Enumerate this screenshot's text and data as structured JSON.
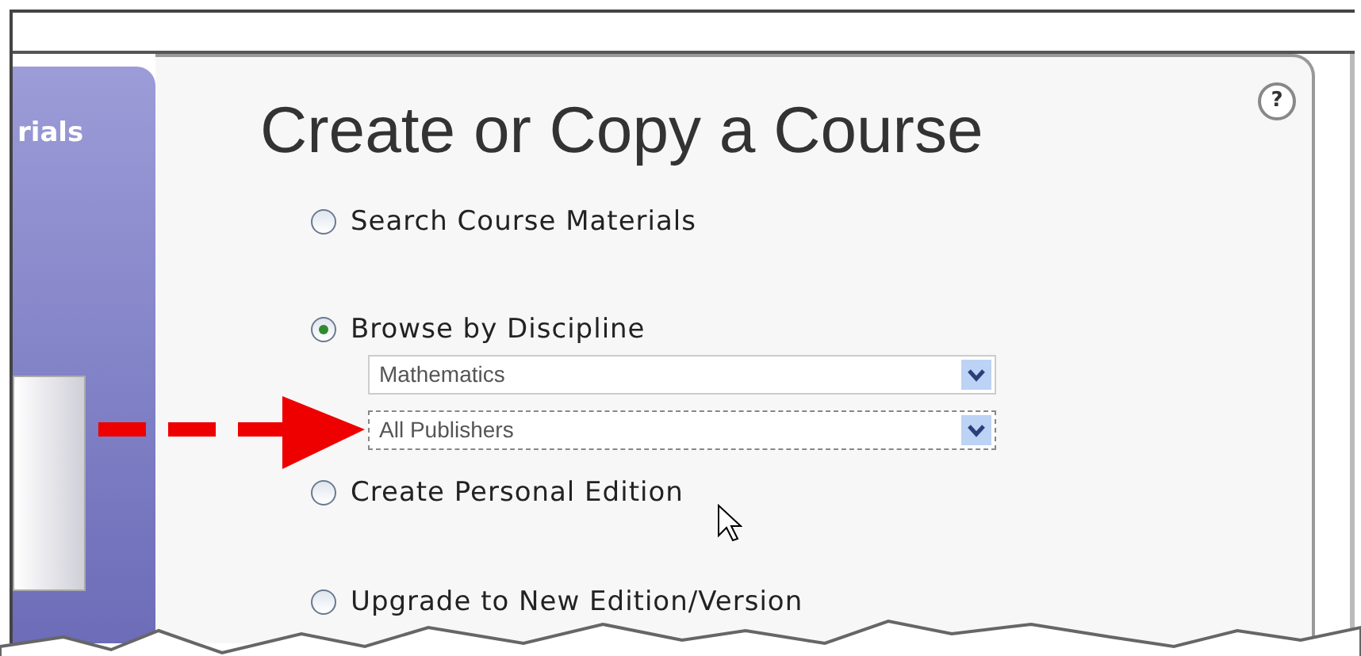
{
  "sidebar": {
    "label": "rials"
  },
  "title": "Create or Copy a Course",
  "help": "?",
  "options": [
    {
      "label": "Search Course Materials",
      "selected": false
    },
    {
      "label": "Browse by Discipline",
      "selected": true,
      "dropdowns": [
        {
          "value": "Mathematics",
          "focused": false
        },
        {
          "value": "All Publishers",
          "focused": true
        }
      ]
    },
    {
      "label": "Create Personal Edition",
      "selected": false
    },
    {
      "label": "Upgrade to New Edition/Version",
      "selected": false
    }
  ]
}
